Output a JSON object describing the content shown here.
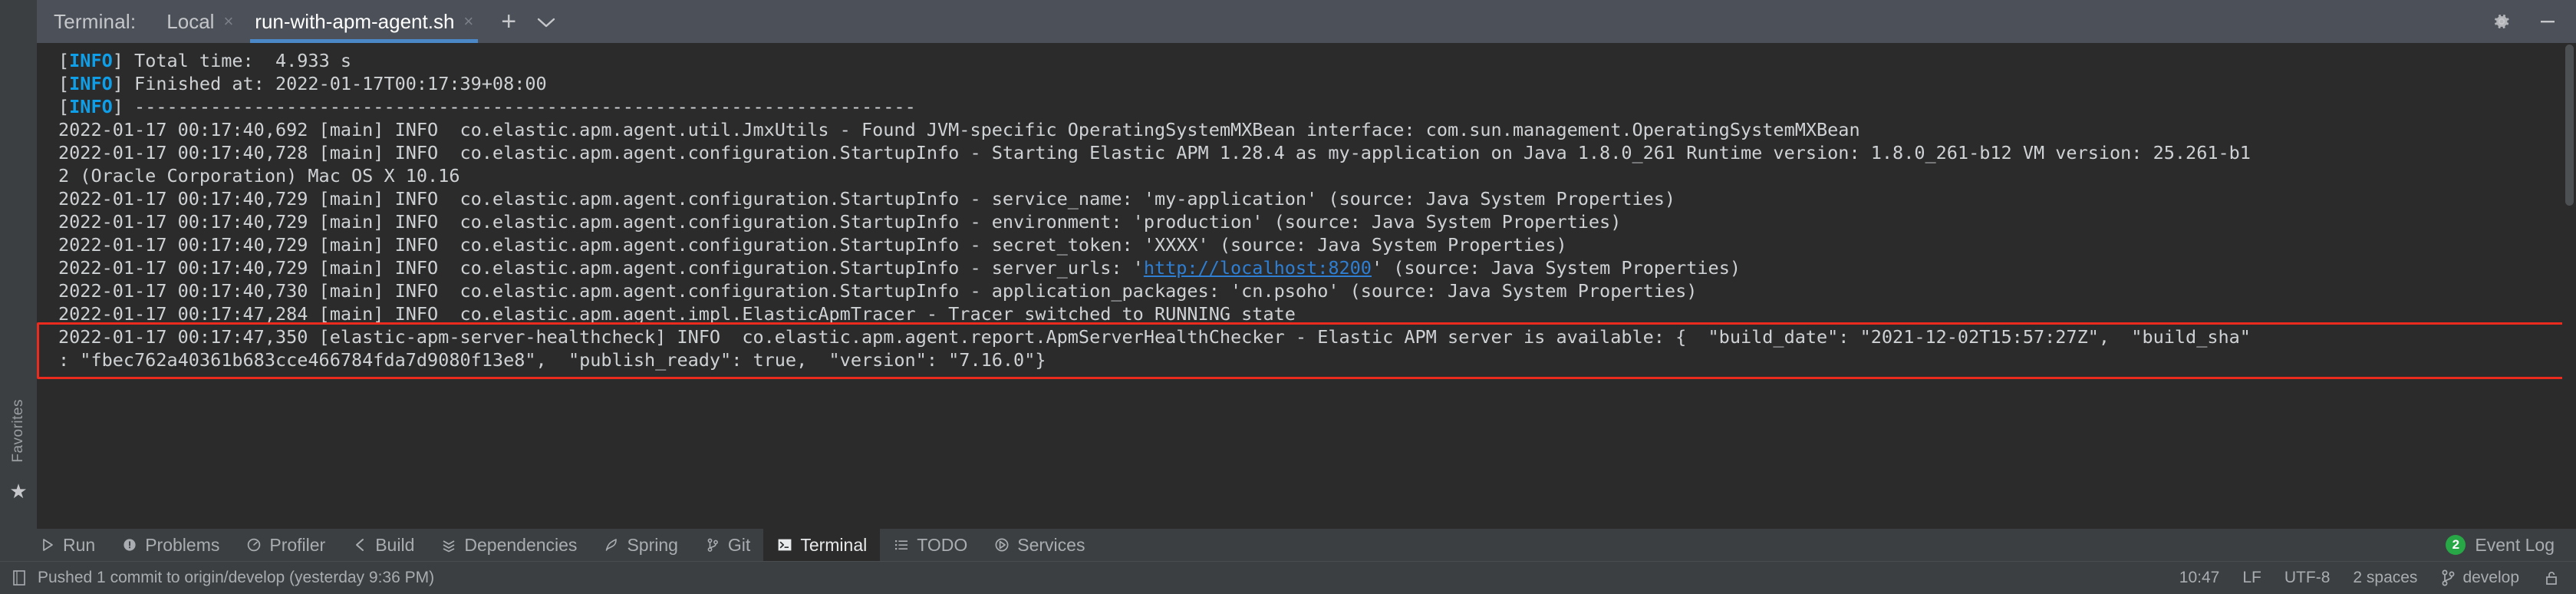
{
  "tabbar": {
    "label": "Terminal:",
    "tabs": [
      {
        "name": "Local",
        "active": false,
        "closable": true
      },
      {
        "name": "run-with-apm-agent.sh",
        "active": true,
        "closable": true
      }
    ],
    "add_label": "+",
    "dropdown_label": "⌄",
    "settings_icon": "gear-icon",
    "minimize_icon": "minimize-icon",
    "close_glyph": "×"
  },
  "favorites": {
    "label": "Favorites",
    "star_glyph": "★"
  },
  "terminal": {
    "lines": [
      [
        {
          "t": "[",
          "c": "dim"
        },
        {
          "t": "INFO",
          "c": "info"
        },
        {
          "t": "] Total time:  4.933 s",
          "c": "dim"
        }
      ],
      [
        {
          "t": "[",
          "c": "dim"
        },
        {
          "t": "INFO",
          "c": "info"
        },
        {
          "t": "] Finished at: 2022-01-17T00:17:39+08:00",
          "c": "dim"
        }
      ],
      [
        {
          "t": "[",
          "c": "dim"
        },
        {
          "t": "INFO",
          "c": "info"
        },
        {
          "t": "] ------------------------------------------------------------------------",
          "c": "dim"
        }
      ],
      [
        {
          "t": "2022-01-17 00:17:40,692 [main] INFO  co.elastic.apm.agent.util.JmxUtils - Found JVM-specific OperatingSystemMXBean interface: com.sun.management.OperatingSystemMXBean",
          "c": "dim"
        }
      ],
      [
        {
          "t": "2022-01-17 00:17:40,728 [main] INFO  co.elastic.apm.agent.configuration.StartupInfo - Starting Elastic APM 1.28.4 as my-application on Java 1.8.0_261 Runtime version: 1.8.0_261-b12 VM version: 25.261-b1",
          "c": "dim"
        }
      ],
      [
        {
          "t": "2 (Oracle Corporation) Mac OS X 10.16",
          "c": "dim"
        }
      ],
      [
        {
          "t": "2022-01-17 00:17:40,729 [main] INFO  co.elastic.apm.agent.configuration.StartupInfo - service_name: 'my-application' (source: Java System Properties)",
          "c": "dim"
        }
      ],
      [
        {
          "t": "2022-01-17 00:17:40,729 [main] INFO  co.elastic.apm.agent.configuration.StartupInfo - environment: 'production' (source: Java System Properties)",
          "c": "dim"
        }
      ],
      [
        {
          "t": "2022-01-17 00:17:40,729 [main] INFO  co.elastic.apm.agent.configuration.StartupInfo - secret_token: 'XXXX' (source: Java System Properties)",
          "c": "dim"
        }
      ],
      [
        {
          "t": "2022-01-17 00:17:40,729 [main] INFO  co.elastic.apm.agent.configuration.StartupInfo - server_urls: '",
          "c": "dim"
        },
        {
          "t": "http://localhost:8200",
          "c": "link"
        },
        {
          "t": "' (source: Java System Properties)",
          "c": "dim"
        }
      ],
      [
        {
          "t": "2022-01-17 00:17:40,730 [main] INFO  co.elastic.apm.agent.configuration.StartupInfo - application_packages: 'cn.psoho' (source: Java System Properties)",
          "c": "dim"
        }
      ],
      [
        {
          "t": "2022-01-17 00:17:47,284 [main] INFO  co.elastic.apm.agent.impl.ElasticApmTracer - Tracer switched to RUNNING state",
          "c": "dim"
        }
      ],
      [
        {
          "t": "2022-01-17 00:17:47,350 [elastic-apm-server-healthcheck] INFO  co.elastic.apm.agent.report.ApmServerHealthChecker - Elastic APM server is available: {  \"build_date\": \"2021-12-02T15:57:27Z\",  \"build_sha\"",
          "c": "dim"
        }
      ],
      [
        {
          "t": ": \"fbec762a40361b683cce466784fda7d9080f13e8\",  \"publish_ready\": true,  \"version\": \"7.16.0\"}",
          "c": "dim"
        }
      ]
    ],
    "highlight_color": "#ec2b1f"
  },
  "toolwindow": {
    "items": [
      {
        "label": "Run",
        "icon": "run-icon",
        "active": false
      },
      {
        "label": "Problems",
        "icon": "problems-icon",
        "active": false
      },
      {
        "label": "Profiler",
        "icon": "profiler-icon",
        "active": false
      },
      {
        "label": "Build",
        "icon": "build-icon",
        "active": false
      },
      {
        "label": "Dependencies",
        "icon": "dependencies-icon",
        "active": false
      },
      {
        "label": "Spring",
        "icon": "spring-icon",
        "active": false
      },
      {
        "label": "Git",
        "icon": "git-icon",
        "active": false
      },
      {
        "label": "Terminal",
        "icon": "terminal-icon",
        "active": true
      },
      {
        "label": "TODO",
        "icon": "todo-icon",
        "active": false
      },
      {
        "label": "Services",
        "icon": "services-icon",
        "active": false
      }
    ],
    "event_log": {
      "label": "Event Log",
      "count": "2",
      "badge_color": "#27a745"
    }
  },
  "statusbar": {
    "message": "Pushed 1 commit to origin/develop (yesterday 9:36 PM)",
    "message_icon": "document-icon",
    "time": "10:47",
    "line_separator": "LF",
    "encoding": "UTF-8",
    "indent": "2 spaces",
    "branch": "develop",
    "branch_icon": "git-branch-icon",
    "lock_icon": "unlock-icon"
  }
}
